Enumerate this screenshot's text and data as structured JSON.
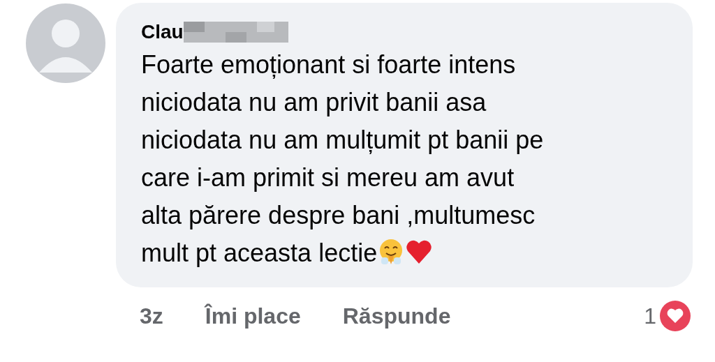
{
  "comment": {
    "author": "Clau",
    "text_lines": [
      "Foarte emoționant si foarte intens",
      "niciodata nu am privit banii asa",
      "niciodata nu am mulțumit pt banii pe",
      "care i-am primit si mereu am avut",
      "alta părere despre bani ,multumesc",
      "mult pt aceasta lectie"
    ]
  },
  "footer": {
    "time": "3z",
    "like": "Îmi place",
    "reply": "Răspunde",
    "reaction_count": "1"
  }
}
